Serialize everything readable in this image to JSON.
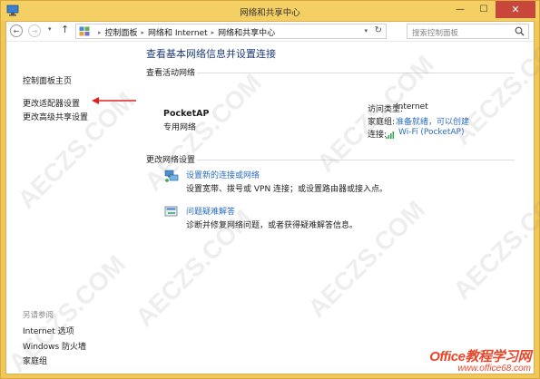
{
  "window": {
    "title": "网络和共享中心"
  },
  "nav": {
    "breadcrumbs": [
      "控制面板",
      "网络和 Internet",
      "网络和共享中心"
    ],
    "search_placeholder": "搜索控制面板"
  },
  "sidebar": {
    "links": [
      "控制面板主页",
      "更改适配器设置",
      "更改高级共享设置"
    ],
    "see_also_heading": "另请参阅",
    "see_also_links": [
      "Internet 选项",
      "Windows 防火墙",
      "家庭组"
    ]
  },
  "main": {
    "title": "查看基本网络信息并设置连接",
    "active_networks_header": "查看活动网络",
    "network": {
      "name": "PocketAP",
      "type": "专用网络",
      "access_type_label": "访问类型:",
      "access_type_value": "Internet",
      "homegroup_label": "家庭组:",
      "homegroup_value": "准备就绪，可以创建",
      "connections_label": "连接:",
      "connections_value": "Wi-Fi (PocketAP)"
    },
    "change_settings_header": "更改网络设置",
    "tasks": [
      {
        "title": "设置新的连接或网络",
        "desc": "设置宽带、拨号或 VPN 连接；或设置路由器或接入点。"
      },
      {
        "title": "问题疑难解答",
        "desc": "诊断并修复网络问题，或者获得疑难解答信息。"
      }
    ]
  },
  "watermark": {
    "text": "AECZS.COM",
    "brand_name": "Office教程学习网",
    "brand_url": "www.office68.com"
  },
  "colors": {
    "titlebar": "#f3cf64",
    "close_button": "#c7473b",
    "link": "#2a6dbd",
    "title_text": "#1e3b78",
    "arrow": "#e02020",
    "brand": "#e8462a"
  }
}
